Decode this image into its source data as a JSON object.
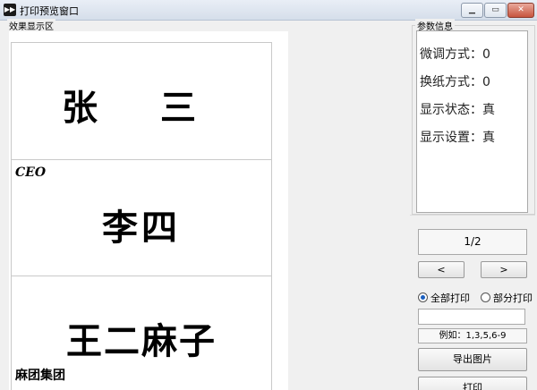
{
  "window": {
    "title": "打印预览窗口"
  },
  "preview": {
    "label": "效果显示区",
    "cards": [
      {
        "name": "张 三",
        "tag": "",
        "company": ""
      },
      {
        "name": "李四",
        "tag": "CEO",
        "company": ""
      },
      {
        "name": "王二麻子",
        "tag": "",
        "company": "麻团集团"
      }
    ]
  },
  "info": {
    "label": "参数信息",
    "lines": [
      "微调方式：0",
      "换纸方式：0",
      "显示状态：真",
      "显示设置：真"
    ]
  },
  "nav": {
    "page": "1/2",
    "prev": "<",
    "next": ">"
  },
  "print_options": {
    "all_label": "全部打印",
    "partial_label": "部分打印",
    "selected": "all",
    "range_value": "",
    "example": "例如：1,3,5,6-9"
  },
  "actions": {
    "export_label": "导出图片",
    "print_label": "打印"
  }
}
